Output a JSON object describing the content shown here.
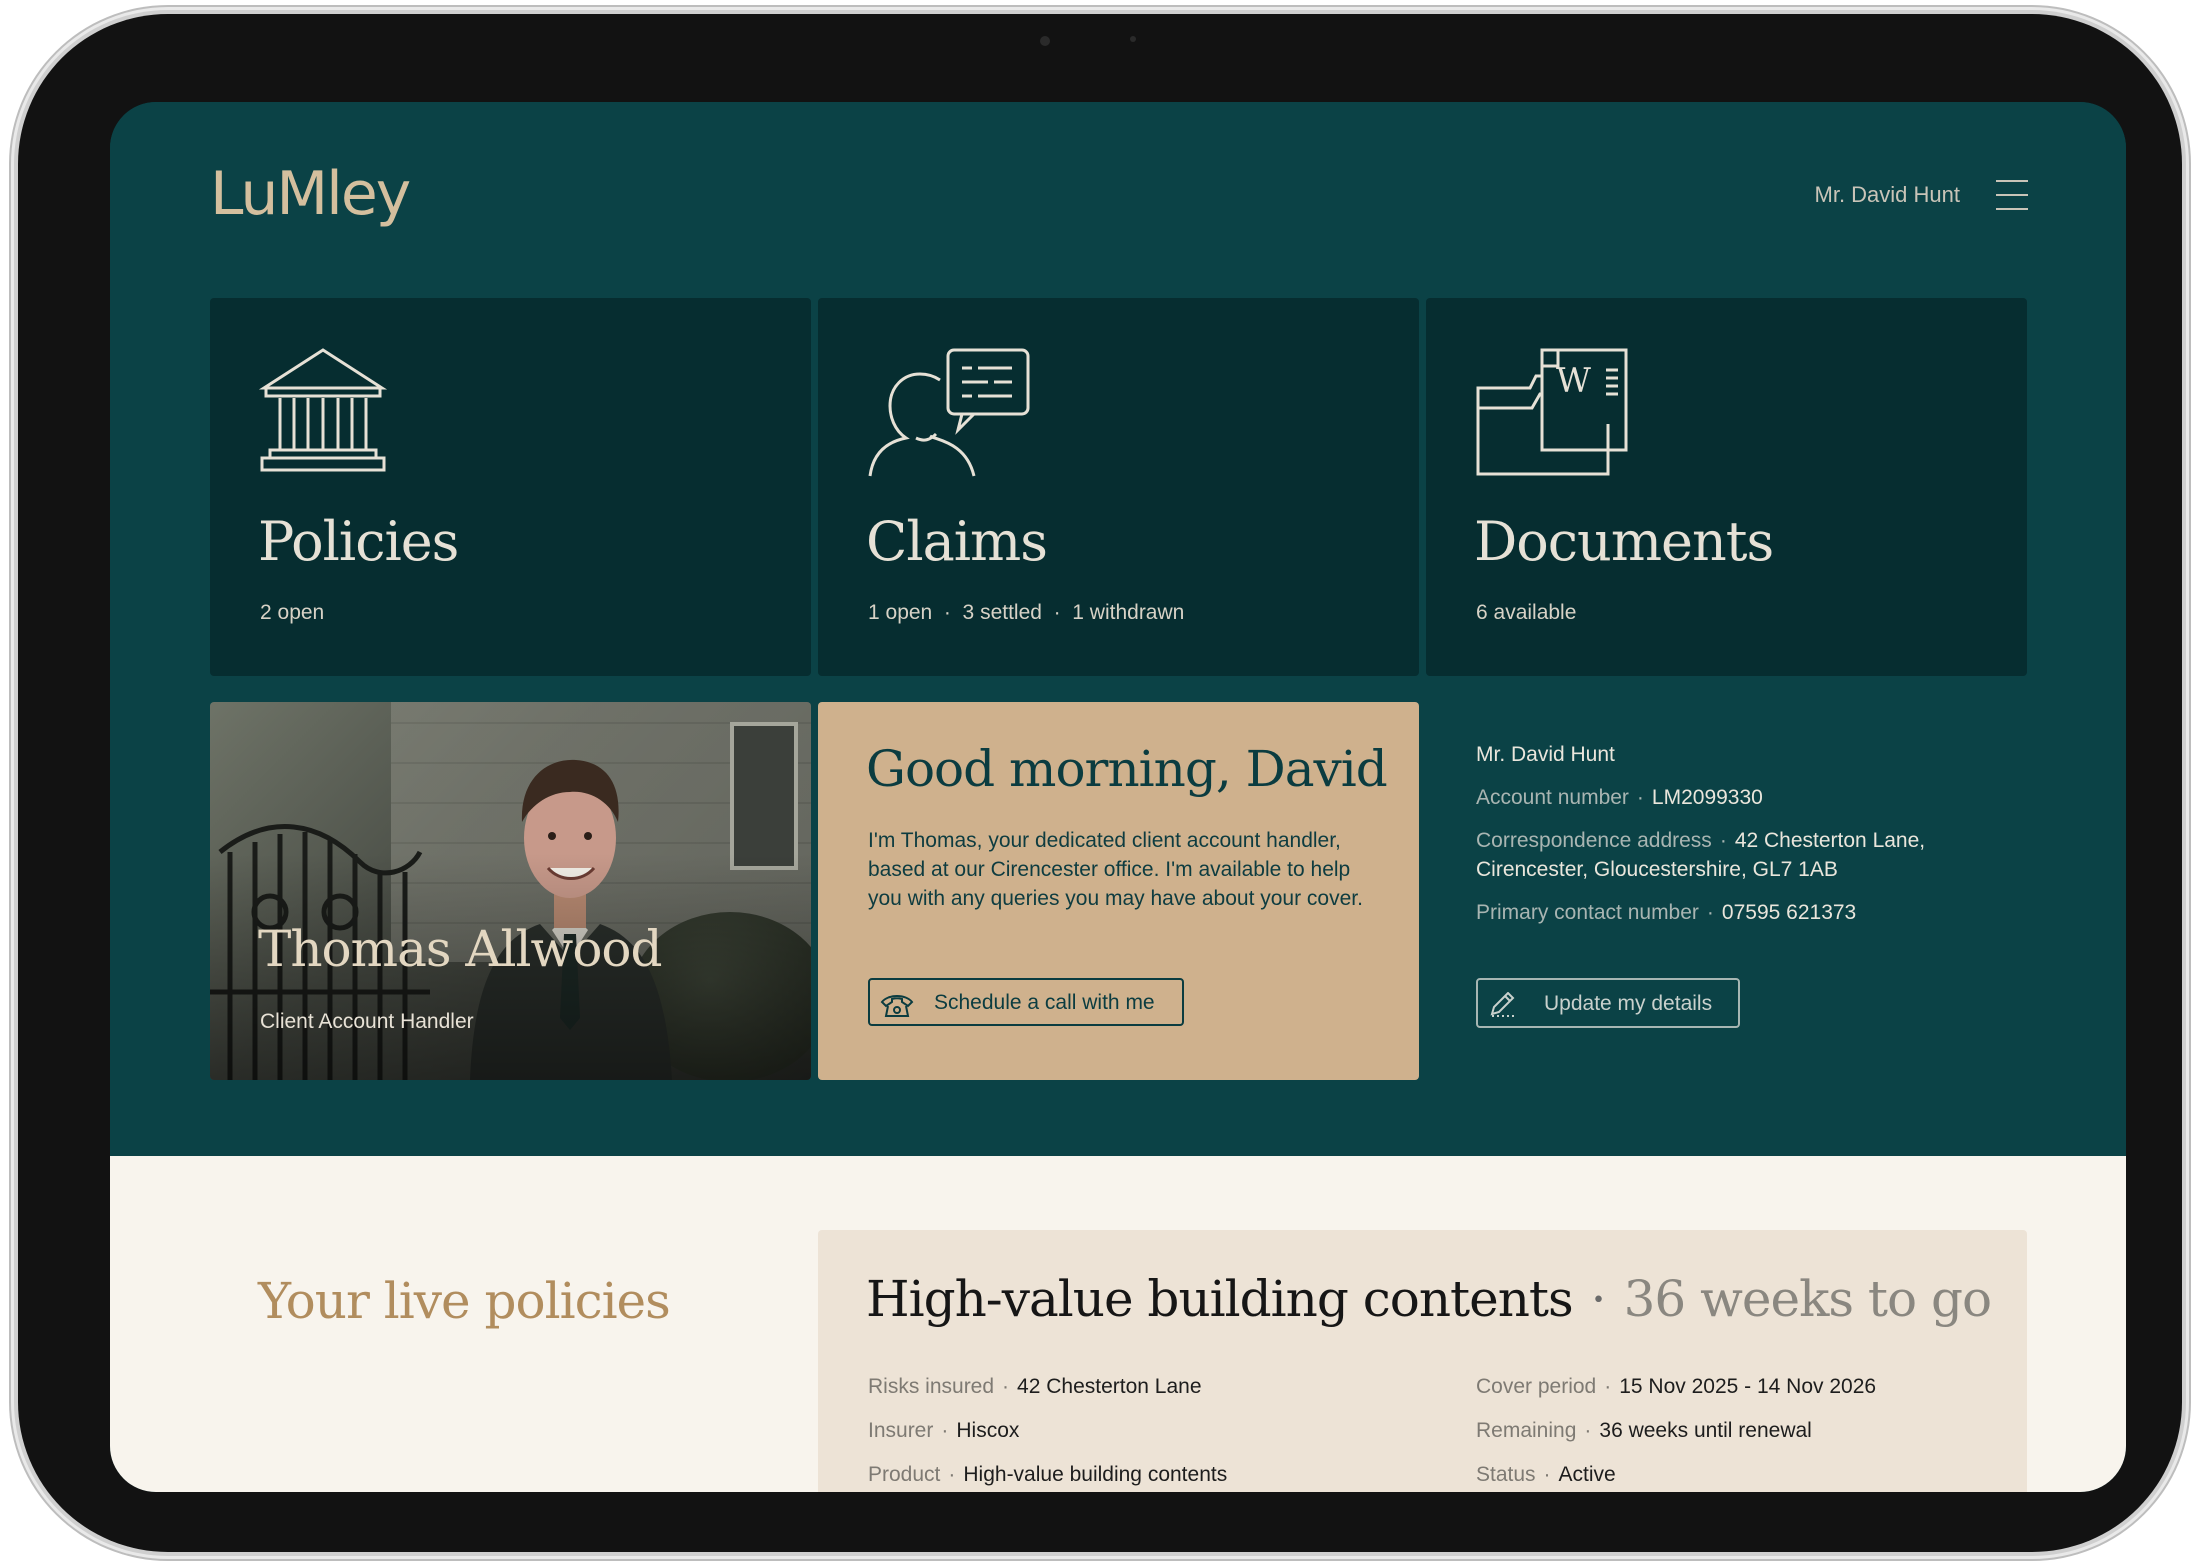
{
  "brand": {
    "logo": "LuMley"
  },
  "header": {
    "user_name": "Mr. David Hunt",
    "menu_icon": "hamburger-icon"
  },
  "tiles": [
    {
      "title": "Policies",
      "subtitle": "2 open",
      "icon": "bank-building-icon"
    },
    {
      "title": "Claims",
      "subtitle": "1 open  ·  3 settled  ·  1 withdrawn",
      "icon": "person-speech-bubble-icon"
    },
    {
      "title": "Documents",
      "subtitle": "6 available",
      "icon": "folder-document-icon"
    }
  ],
  "handler": {
    "name": "Thomas Allwood",
    "role": "Client Account Handler"
  },
  "greeting": {
    "title": "Good morning, David",
    "text": "I'm Thomas, your dedicated client account handler, based at our Cirencester office. I'm available to help you with any queries you may have about your cover.",
    "call_button": "Schedule a call with me",
    "call_icon": "phone-icon"
  },
  "account": {
    "name": "Mr. David Hunt",
    "account_number_label": "Account number",
    "account_number": "LM2099330",
    "address_label": "Correspondence address",
    "address_line1": "42 Chesterton Lane,",
    "address_line2": "Cirencester, Gloucestershire, GL7 1AB",
    "phone_label": "Primary contact number",
    "phone": "07595 621373",
    "update_button": "Update my details",
    "update_icon": "pencil-icon"
  },
  "policies_section": {
    "title": "Your live policies",
    "policy": {
      "name": "High-value building contents",
      "weeks_to_go": "36 weeks to go",
      "left": [
        {
          "label": "Risks insured",
          "value": "42 Chesterton Lane"
        },
        {
          "label": "Insurer",
          "value": "Hiscox"
        },
        {
          "label": "Product",
          "value": "High-value building contents"
        }
      ],
      "right": [
        {
          "label": "Cover period",
          "value": "15 Nov 2025 - 14 Nov 2026"
        },
        {
          "label": "Remaining",
          "value": "36 weeks until renewal"
        },
        {
          "label": "Status",
          "value": "Active"
        }
      ]
    }
  },
  "colors": {
    "hero_bg": "#0b4246",
    "tile_bg": "#062d30",
    "accent_tan": "#cfb18d",
    "logo": "#d4bf9e",
    "lower_bg": "#f8f4ed",
    "policy_card_bg": "#ede3d6"
  }
}
